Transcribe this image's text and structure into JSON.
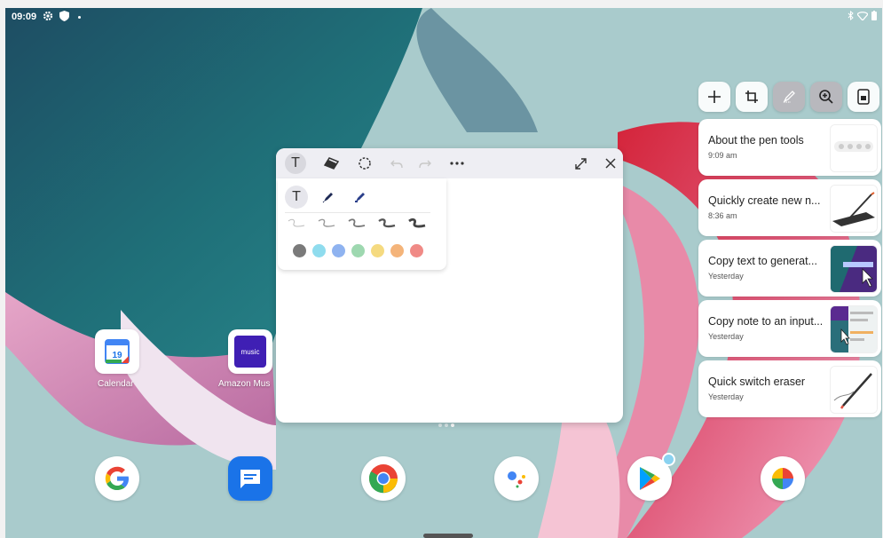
{
  "status_bar": {
    "time": "09:09"
  },
  "home": {
    "apps": [
      {
        "label": "Calendar",
        "badge": "19"
      },
      {
        "label": "Amazon Mus",
        "badge": "music"
      }
    ],
    "dock": [
      "google",
      "messages",
      "chrome",
      "assistant",
      "play-store",
      "photos"
    ]
  },
  "note_window": {
    "tools": [
      "text",
      "eraser",
      "lasso",
      "undo",
      "redo",
      "more",
      "expand",
      "close"
    ],
    "pen_types": [
      "text",
      "pen",
      "marker"
    ],
    "colors": [
      "#7a7a7a",
      "#8fdcee",
      "#8fb3f0",
      "#9ed8b0",
      "#f5da80",
      "#f4b47a",
      "#f08a86"
    ]
  },
  "pen_tools": {
    "buttons": [
      "add",
      "crop",
      "pen",
      "zoom",
      "note"
    ]
  },
  "cards": [
    {
      "title": "About the pen tools",
      "time": "9:09 am"
    },
    {
      "title": "Quickly create new n...",
      "time": "8:36 am"
    },
    {
      "title": "Copy text to generat...",
      "time": "Yesterday"
    },
    {
      "title": "Copy note to an input...",
      "time": "Yesterday"
    },
    {
      "title": "Quick switch eraser",
      "time": "Yesterday"
    }
  ]
}
